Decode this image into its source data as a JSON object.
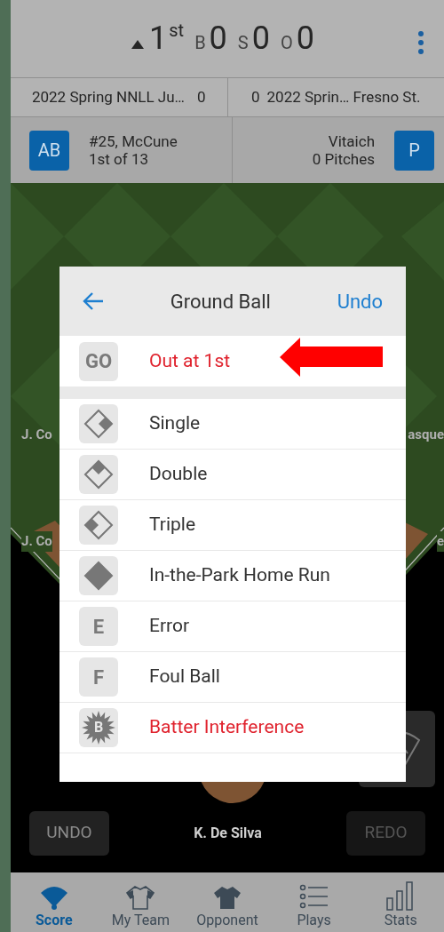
{
  "scoreboard": {
    "inning": "1",
    "inning_suffix": "st",
    "counts": [
      {
        "label": "B",
        "value": "0"
      },
      {
        "label": "S",
        "value": "0"
      },
      {
        "label": "O",
        "value": "0"
      }
    ]
  },
  "teams": [
    {
      "name": "2022 Spring NNLL Ju…",
      "score": "0"
    },
    {
      "name": "2022 Sprin… Fresno St.",
      "score": "0"
    }
  ],
  "batter": {
    "badge": "AB",
    "name": "#25, McCune",
    "detail": "1st of 13"
  },
  "pitcher": {
    "badge": "P",
    "name": "Vitaich",
    "detail": "0 Pitches"
  },
  "field_labels": [
    "J. Co",
    "asque",
    "J. Co",
    "e"
  ],
  "dialog": {
    "title": "Ground Ball",
    "action": "Undo",
    "sections": [
      [
        {
          "kind": "text",
          "icon_text": "GO",
          "label": "Out at 1st",
          "alert": true
        }
      ],
      [
        {
          "kind": "single",
          "label": "Single",
          "alert": false
        },
        {
          "kind": "double",
          "label": "Double",
          "alert": false
        },
        {
          "kind": "triple",
          "label": "Triple",
          "alert": false
        },
        {
          "kind": "homerun",
          "label": "In-the-Park Home Run",
          "alert": false
        },
        {
          "kind": "text",
          "icon_text": "E",
          "label": "Error",
          "alert": false
        },
        {
          "kind": "text",
          "icon_text": "F",
          "label": "Foul Ball",
          "alert": false
        },
        {
          "kind": "burst",
          "icon_text": "B",
          "label": "Batter Interference",
          "alert": true
        }
      ]
    ]
  },
  "controls": {
    "undo": "UNDO",
    "player": "K. De Silva",
    "redo": "REDO",
    "redo_disabled": true
  },
  "tabs": [
    {
      "label": "Score",
      "kind": "field",
      "selected": true
    },
    {
      "label": "My Team",
      "kind": "jersey",
      "selected": false
    },
    {
      "label": "Opponent",
      "kind": "filled-jersey",
      "selected": false
    },
    {
      "label": "Plays",
      "kind": "list",
      "selected": false
    },
    {
      "label": "Stats",
      "kind": "chart",
      "selected": false
    }
  ]
}
